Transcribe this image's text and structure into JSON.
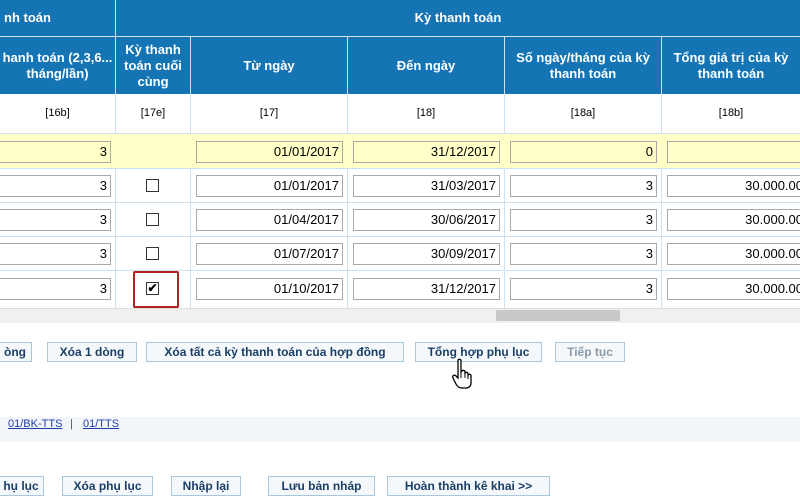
{
  "header": {
    "group_left": "nh toán",
    "group_right": "Kỳ thanh toán",
    "col_freq": "hanh toán (2,3,6... tháng/lần)",
    "col_last": "Kỳ thanh toán cuối cùng",
    "col_from": "Từ ngày",
    "col_to": "Đến ngày",
    "col_days": "Số ngày/tháng của kỳ thanh toán",
    "col_total": "Tổng giá trị của kỳ thanh toán"
  },
  "codes": [
    "[16b]",
    "[17e]",
    "[17]",
    "[18]",
    "[18a]",
    "[18b]"
  ],
  "rows": [
    {
      "freq": "3",
      "last_checked": null,
      "from": "01/01/2017",
      "to": "31/12/2017",
      "days": "0",
      "total": ""
    },
    {
      "freq": "3",
      "last_checked": false,
      "from": "01/01/2017",
      "to": "31/03/2017",
      "days": "3",
      "total": "30.000.00"
    },
    {
      "freq": "3",
      "last_checked": false,
      "from": "01/04/2017",
      "to": "30/06/2017",
      "days": "3",
      "total": "30.000.00"
    },
    {
      "freq": "3",
      "last_checked": false,
      "from": "01/07/2017",
      "to": "30/09/2017",
      "days": "3",
      "total": "30.000.00"
    },
    {
      "freq": "3",
      "last_checked": true,
      "from": "01/10/2017",
      "to": "31/12/2017",
      "days": "3",
      "total": "30.000.00"
    }
  ],
  "check_mark": "✔",
  "actions": {
    "add_row": "òng",
    "delete_row": "Xóa 1 dòng",
    "delete_all": "Xóa tất cả kỳ thanh toán của hợp đồng",
    "summarize": "Tổng hợp phụ lục",
    "continue": "Tiếp tục"
  },
  "links": {
    "bk_tts": "01/BK-TTS",
    "separator": "|",
    "tts": "01/TTS"
  },
  "bottom": {
    "appendix": "hụ lục",
    "delete_appendix": "Xóa phụ lục",
    "reenter": "Nhập lại",
    "save_draft": "Lưu bản nháp",
    "finish": "Hoàn thành kê khai >>"
  },
  "colors": {
    "header_bg": "#1474b4",
    "highlight": "#b22222",
    "yellow_row": "#ffffc8"
  }
}
